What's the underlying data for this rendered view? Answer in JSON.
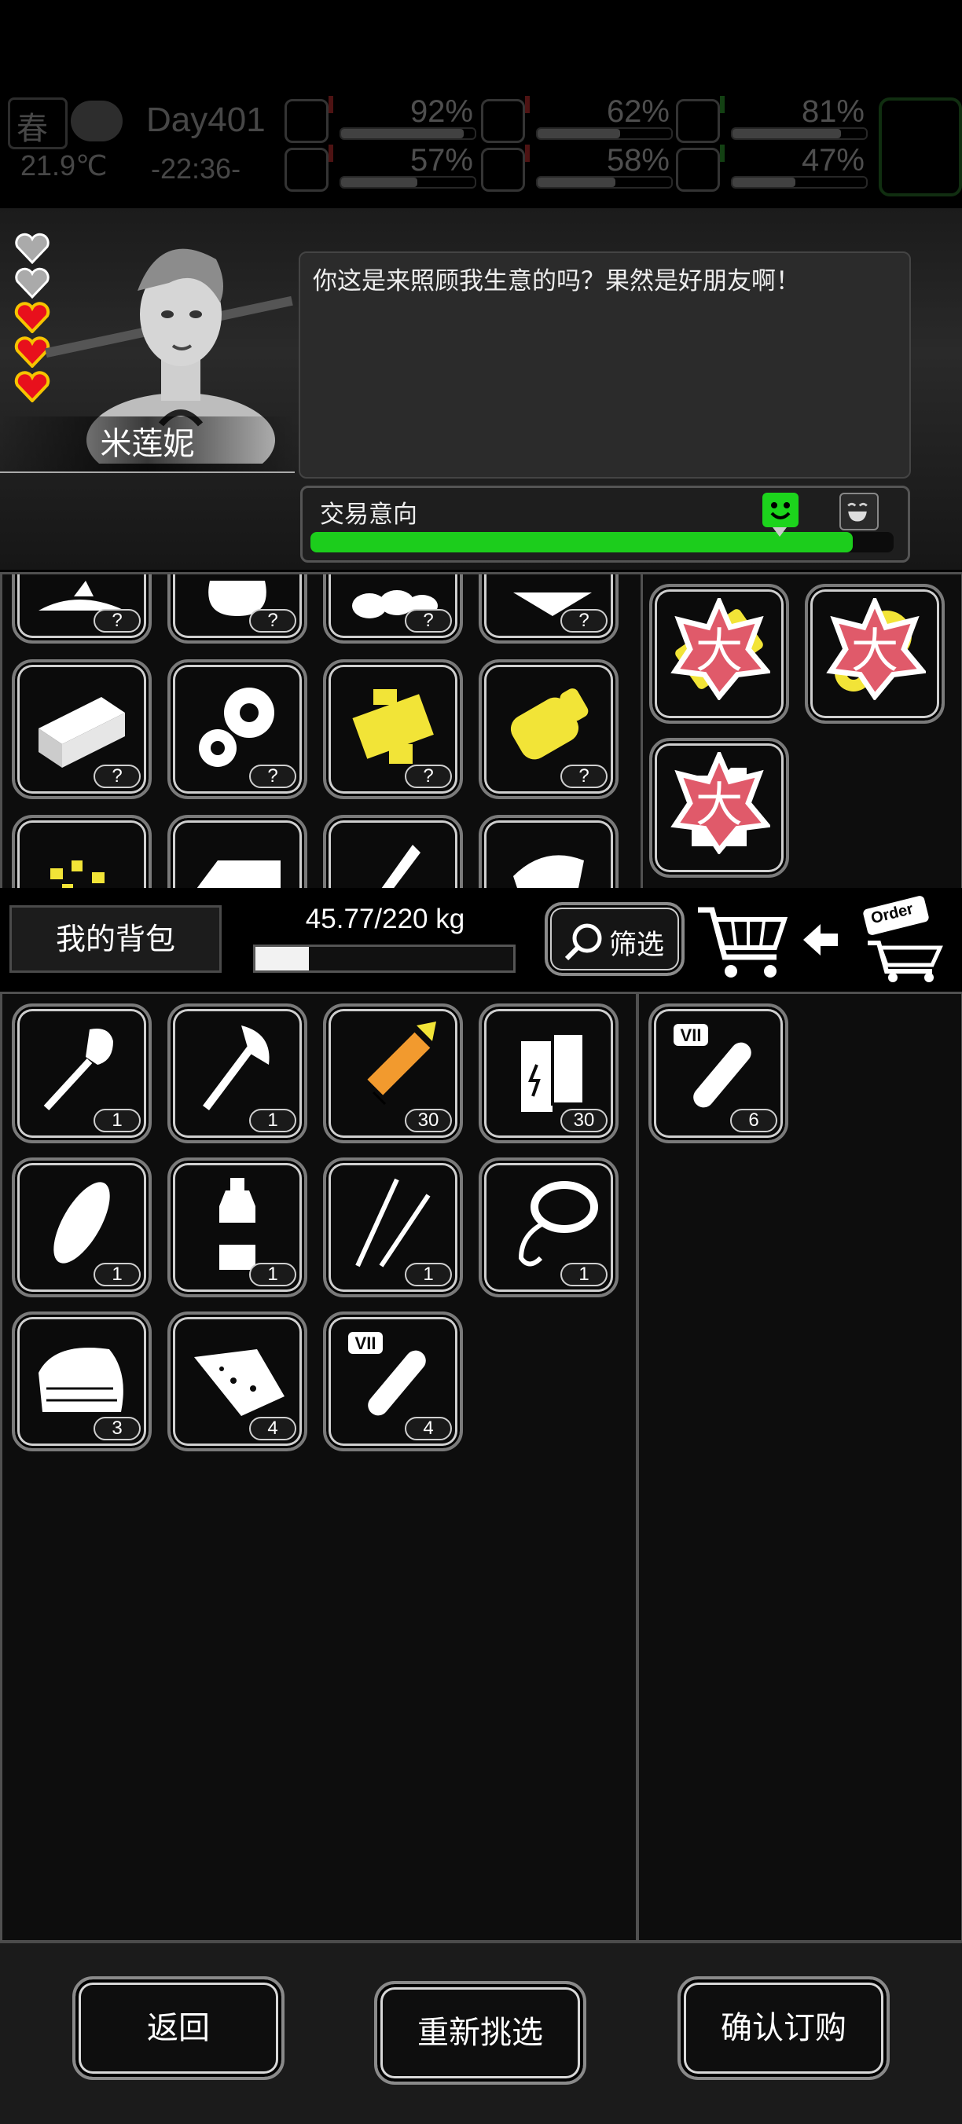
{
  "hud": {
    "season": "春",
    "day": "Day401",
    "temperature": "21.9℃",
    "time": "-22:36-",
    "stats": [
      {
        "name": "medical",
        "value": "92%",
        "level": 0.92,
        "trend": "down"
      },
      {
        "name": "hunger",
        "value": "62%",
        "level": 0.62,
        "trend": "down"
      },
      {
        "name": "mood",
        "value": "81%",
        "level": 0.81,
        "trend": "up"
      },
      {
        "name": "stamina",
        "value": "57%",
        "level": 0.57,
        "trend": "down"
      },
      {
        "name": "thirst",
        "value": "58%",
        "level": 0.58,
        "trend": "down"
      },
      {
        "name": "health",
        "value": "47%",
        "level": 0.47,
        "trend": "up"
      }
    ]
  },
  "npc": {
    "name": "米莲妮",
    "hearts_total": 5,
    "hearts_filled": 3,
    "dialog": "你这是来照顾我生意的吗？果然是好朋友啊！"
  },
  "trade": {
    "label": "交易意向",
    "level": 0.93
  },
  "shop": {
    "grid_badges": [
      "?",
      "?",
      "?",
      "?",
      "?",
      "?",
      "?",
      "?"
    ],
    "grid_icons": [
      "fish-icon",
      "sack-icon",
      "eggs-icon",
      "paper-icon",
      "brick-icon",
      "gears-icon",
      "circuit-icon",
      "battery-icon",
      "gold-nuggets-icon",
      "cloth-icon",
      "blade-icon",
      "leather-icon"
    ],
    "selected": [
      {
        "icon": "gold-plate-icon",
        "badge": "大"
      },
      {
        "icon": "gold-gears-icon",
        "badge": "大"
      },
      {
        "icon": "jerrycan-icon",
        "badge": "大"
      }
    ]
  },
  "inventory": {
    "title": "我的背包",
    "weight": "45.77/220 kg",
    "weight_level": 0.208,
    "filter_label": "筛选",
    "items": [
      {
        "icon": "shovel-icon",
        "count": "1"
      },
      {
        "icon": "axe-icon",
        "count": "1"
      },
      {
        "icon": "ammo-icon",
        "count": "30"
      },
      {
        "icon": "batteries-icon",
        "count": "30"
      },
      {
        "icon": "bread-icon",
        "count": "1"
      },
      {
        "icon": "bottle-icon",
        "count": "1"
      },
      {
        "icon": "lockpick-icon",
        "count": "1"
      },
      {
        "icon": "rope-icon",
        "count": "1"
      },
      {
        "icon": "cloth-icon",
        "count": "3"
      },
      {
        "icon": "jerky-icon",
        "count": "4"
      },
      {
        "icon": "test-tube-icon",
        "count": "4",
        "tag": "VII"
      }
    ],
    "offer": [
      {
        "icon": "test-tube-icon",
        "count": "6",
        "tag": "VII"
      }
    ]
  },
  "order_icon_text": "Order",
  "buttons": {
    "back": "返回",
    "reselect": "重新挑选",
    "confirm": "确认订购"
  },
  "colors": {
    "trade_bar": "#1ccd1c",
    "big_badge": "#e05a6a",
    "gold": "#f2e437",
    "orange": "#f29a2e"
  }
}
